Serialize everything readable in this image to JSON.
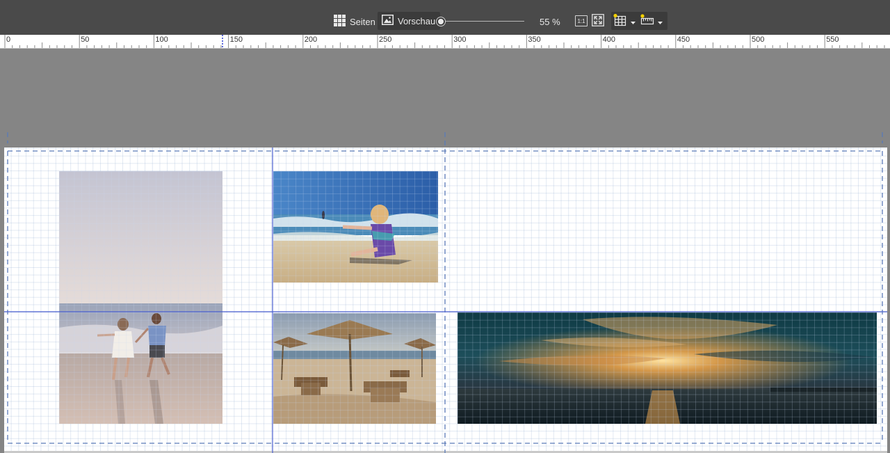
{
  "toolbar": {
    "pages_label": "Seiten",
    "preview_label": "Vorschau",
    "zoom_value": "55 %",
    "zoom_level_fraction": 0.0,
    "actual_size_label": "1:1",
    "icons": {
      "pages": "grid-icon",
      "preview": "image-icon",
      "fit": "fit-to-window-icon",
      "grid": "grid-settings-icon",
      "ruler": "ruler-settings-icon",
      "dropdown": "chevron-down-icon"
    }
  },
  "ruler": {
    "labels": [
      "0",
      "50",
      "100",
      "150",
      "200",
      "250",
      "300",
      "350",
      "400",
      "450",
      "500",
      "550"
    ]
  },
  "canvas": {
    "photos": [
      {
        "name": "photo-couple-running-beach",
        "subject": "couple running on beach"
      },
      {
        "name": "photo-child-on-beach",
        "subject": "child on beach"
      },
      {
        "name": "photo-beach-umbrellas",
        "subject": "beach umbrellas"
      },
      {
        "name": "photo-sunset-panorama",
        "subject": "sunset panorama"
      }
    ]
  },
  "colors": {
    "toolbar_bg": "#4a4a4a",
    "workspace_bg": "#858585",
    "guide_blue": "#4a5fd0",
    "guide_dash": "#5a7ab8"
  }
}
